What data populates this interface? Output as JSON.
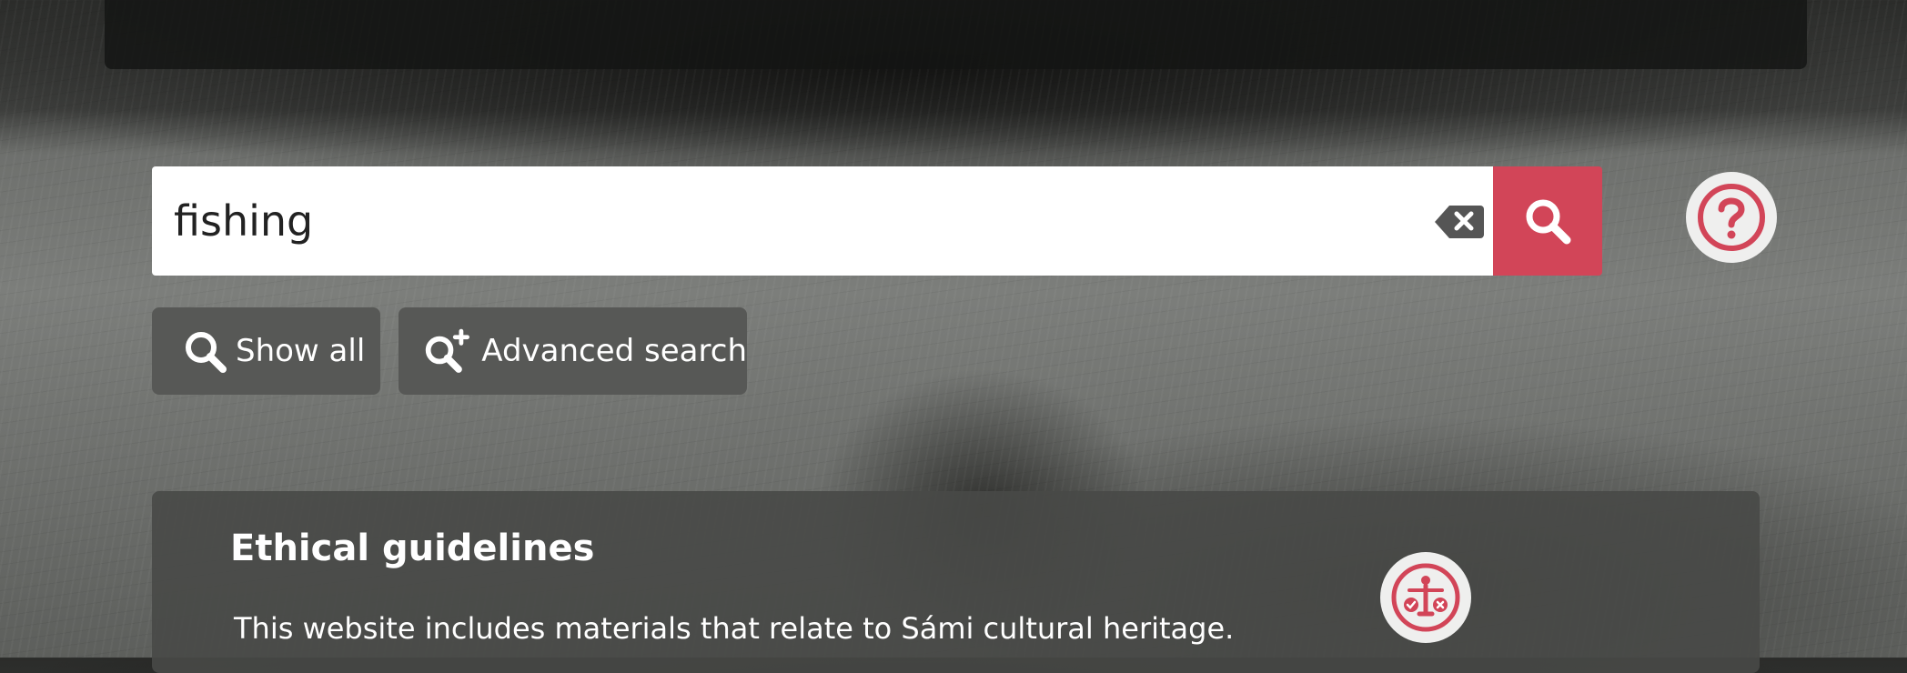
{
  "search": {
    "value": "fishing",
    "clear_icon": "clear-input-icon",
    "submit_icon": "search-icon",
    "help_icon": "help-question-icon"
  },
  "buttons": {
    "show_all": {
      "label": "Show all",
      "icon": "search-icon"
    },
    "advanced_search": {
      "label": "Advanced search",
      "icon": "search-plus-icon"
    }
  },
  "info_card": {
    "title": "Ethical guidelines",
    "text": "This website includes materials that relate to Sámi cultural heritage.",
    "icon": "ethics-scale-person-icon"
  },
  "colors": {
    "accent": "#d24558",
    "button_bg": "#575856",
    "card_bg": "#484947",
    "icon_bg": "#efefee"
  }
}
